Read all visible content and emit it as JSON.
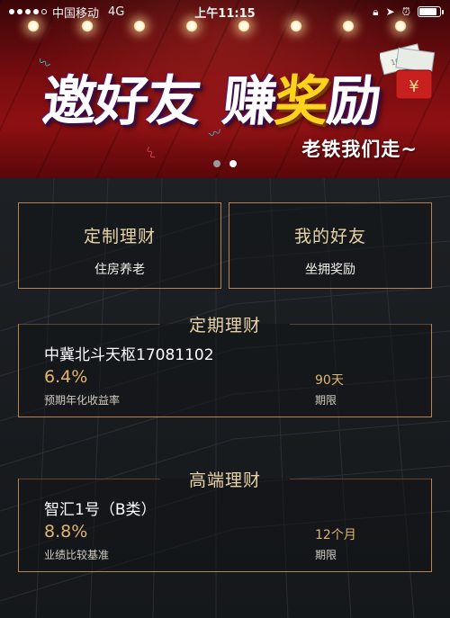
{
  "status_bar": {
    "carrier": "中国移动",
    "network": "4G",
    "time": "上午11:15",
    "battery_level": 0.85
  },
  "banner": {
    "title_part1": "邀好友",
    "title_part2_a": "赚",
    "title_part2_highlight": "奖",
    "title_part2_b": "励",
    "subtitle": "老铁我们走~",
    "money_symbol": "¥",
    "bill_text": "100元",
    "slide_count": 2,
    "active_slide": 2
  },
  "quick_actions": [
    {
      "title": "定制理财",
      "subtitle": "住房养老"
    },
    {
      "title": "我的好友",
      "subtitle": "坐拥奖励"
    }
  ],
  "sections": [
    {
      "title": "定期理财",
      "product": {
        "name": "中冀北斗天枢17081102",
        "rate": "6.4%",
        "rate_label": "预期年化收益率",
        "term": "90天",
        "term_label": "期限"
      }
    },
    {
      "title": "高端理财",
      "product": {
        "name": "智汇1号（B类）",
        "rate": "8.8%",
        "rate_label": "业绩比较基准",
        "term": "12个月",
        "term_label": "期限"
      }
    }
  ],
  "colors": {
    "accent_gold": "#e1b46f",
    "border_gold": "#b98252",
    "banner_red": "#8d1013",
    "highlight_yellow": "#ffd21e"
  }
}
